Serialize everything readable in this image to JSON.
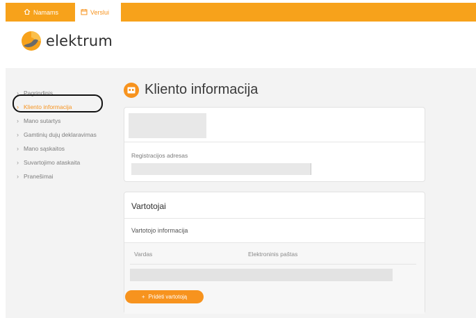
{
  "topnav": {
    "tabs": [
      {
        "label": "Namams",
        "icon": "home-icon"
      },
      {
        "label": "Verslui",
        "icon": "calendar-icon"
      }
    ]
  },
  "brand": {
    "name": "elektrum",
    "accent": "#f7931e",
    "bar": "#f7a21b"
  },
  "sidebar": {
    "items": [
      {
        "label": "Pagrindinis"
      },
      {
        "label": "Kliento informacija",
        "active": true
      },
      {
        "label": "Mano sutartys"
      },
      {
        "label": "Gamtinių dujų deklaravimas"
      },
      {
        "label": "Mano sąskaitos"
      },
      {
        "label": "Suvartojimo ataskaita"
      },
      {
        "label": "Pranešimai"
      }
    ]
  },
  "page": {
    "title": "Kliento informacija",
    "address_label": "Registracijos adresas"
  },
  "users": {
    "heading": "Vartotojai",
    "subheading": "Vartotojo informacija",
    "columns": [
      "Vardas",
      "Elektroninis paštas"
    ],
    "add_button": "Pridėti vartotoją"
  }
}
